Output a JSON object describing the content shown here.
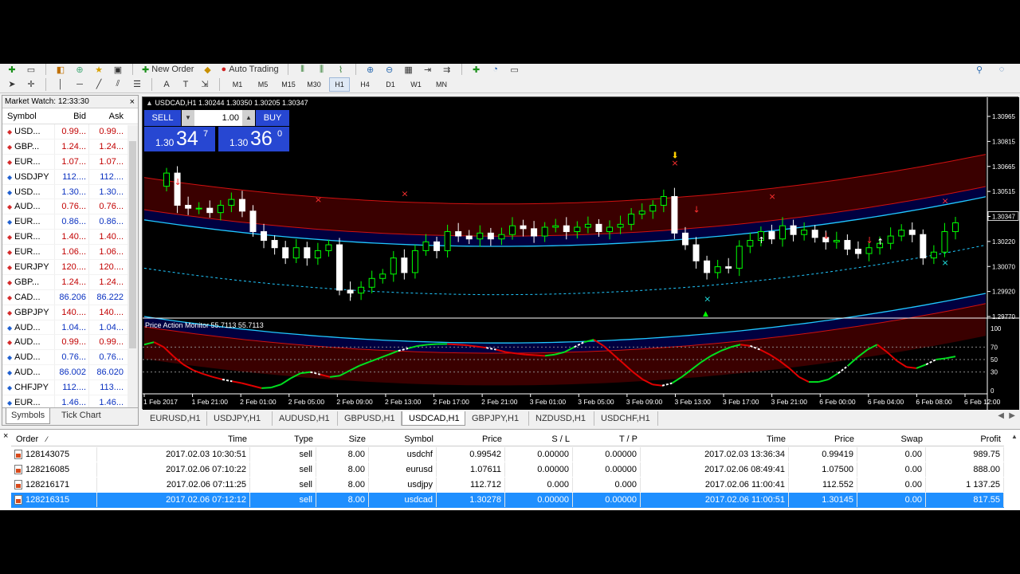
{
  "toolbar": {
    "new_order": "New Order",
    "auto_trading": "Auto Trading",
    "timeframes": [
      "M1",
      "M5",
      "M15",
      "M30",
      "H1",
      "H4",
      "D1",
      "W1",
      "MN"
    ],
    "active_timeframe": "H1"
  },
  "market_watch": {
    "title": "Market Watch: 12:33:30",
    "close": "×",
    "col_symbol": "Symbol",
    "col_bid": "Bid",
    "col_ask": "Ask",
    "rows": [
      {
        "dir": "down",
        "symbol": "USD...",
        "bid": "0.99...",
        "ask": "0.99...",
        "color": "red"
      },
      {
        "dir": "down",
        "symbol": "GBP...",
        "bid": "1.24...",
        "ask": "1.24...",
        "color": "red"
      },
      {
        "dir": "down",
        "symbol": "EUR...",
        "bid": "1.07...",
        "ask": "1.07...",
        "color": "red"
      },
      {
        "dir": "up",
        "symbol": "USDJPY",
        "bid": "112....",
        "ask": "112....",
        "color": "blue"
      },
      {
        "dir": "up",
        "symbol": "USD...",
        "bid": "1.30...",
        "ask": "1.30...",
        "color": "blue"
      },
      {
        "dir": "down",
        "symbol": "AUD...",
        "bid": "0.76...",
        "ask": "0.76...",
        "color": "red"
      },
      {
        "dir": "up",
        "symbol": "EUR...",
        "bid": "0.86...",
        "ask": "0.86...",
        "color": "blue"
      },
      {
        "dir": "down",
        "symbol": "EUR...",
        "bid": "1.40...",
        "ask": "1.40...",
        "color": "red"
      },
      {
        "dir": "down",
        "symbol": "EUR...",
        "bid": "1.06...",
        "ask": "1.06...",
        "color": "red"
      },
      {
        "dir": "down",
        "symbol": "EURJPY",
        "bid": "120....",
        "ask": "120....",
        "color": "red"
      },
      {
        "dir": "down",
        "symbol": "GBP...",
        "bid": "1.24...",
        "ask": "1.24...",
        "color": "red"
      },
      {
        "dir": "down",
        "symbol": "CAD...",
        "bid": "86.206",
        "ask": "86.222",
        "color": "blue"
      },
      {
        "dir": "down",
        "symbol": "GBPJPY",
        "bid": "140....",
        "ask": "140....",
        "color": "red"
      },
      {
        "dir": "up",
        "symbol": "AUD...",
        "bid": "1.04...",
        "ask": "1.04...",
        "color": "blue"
      },
      {
        "dir": "down",
        "symbol": "AUD...",
        "bid": "0.99...",
        "ask": "0.99...",
        "color": "red"
      },
      {
        "dir": "up",
        "symbol": "AUD...",
        "bid": "0.76...",
        "ask": "0.76...",
        "color": "blue"
      },
      {
        "dir": "up",
        "symbol": "AUD...",
        "bid": "86.002",
        "ask": "86.020",
        "color": "blue"
      },
      {
        "dir": "up",
        "symbol": "CHFJPY",
        "bid": "112....",
        "ask": "113....",
        "color": "blue"
      },
      {
        "dir": "up",
        "symbol": "EUR...",
        "bid": "1.46...",
        "ask": "1.46...",
        "color": "blue"
      }
    ],
    "tabs": [
      "Symbols",
      "Tick Chart"
    ]
  },
  "chart": {
    "header": "USDCAD,H1  1.30244 1.30350 1.30205 1.30347",
    "sell": "SELL",
    "buy": "BUY",
    "lot": "1.00",
    "sell_price_small": "1.30",
    "sell_price_big": "34",
    "sell_price_sup": "7",
    "buy_price_small": "1.30",
    "buy_price_big": "36",
    "buy_price_sup": "0",
    "indicator_label": "Price Action Monitor 55.7113 55.7113",
    "price_ticks": [
      "1.30965",
      "1.30815",
      "1.30665",
      "1.30515",
      "1.30347",
      "1.30220",
      "1.30070",
      "1.29920",
      "1.29770"
    ],
    "current_price": "1.30347",
    "osc_ticks": [
      "100",
      "70",
      "50",
      "30",
      "0"
    ],
    "time_labels": [
      "1 Feb 2017",
      "1 Feb 21:00",
      "2 Feb 01:00",
      "2 Feb 05:00",
      "2 Feb 09:00",
      "2 Feb 13:00",
      "2 Feb 17:00",
      "2 Feb 21:00",
      "3 Feb 01:00",
      "3 Feb 05:00",
      "3 Feb 09:00",
      "3 Feb 13:00",
      "3 Feb 17:00",
      "3 Feb 21:00",
      "6 Feb 00:00",
      "6 Feb 04:00",
      "6 Feb 08:00",
      "6 Feb 12:00"
    ]
  },
  "chart_tabs": [
    "EURUSD,H1",
    "USDJPY,H1",
    "AUDUSD,H1",
    "GBPUSD,H1",
    "USDCAD,H1",
    "GBPJPY,H1",
    "NZDUSD,H1",
    "USDCHF,H1"
  ],
  "active_chart_tab": "USDCAD,H1",
  "terminal": {
    "close": "×",
    "headers": {
      "order": "Order",
      "time": "Time",
      "type": "Type",
      "size": "Size",
      "symbol": "Symbol",
      "price": "Price",
      "sl": "S / L",
      "tp": "T / P",
      "time2": "Time",
      "price2": "Price",
      "swap": "Swap",
      "profit": "Profit"
    },
    "rows": [
      {
        "order": "128143075",
        "time": "2017.02.03 10:30:51",
        "type": "sell",
        "size": "8.00",
        "symbol": "usdchf",
        "price": "0.99542",
        "sl": "0.00000",
        "tp": "0.00000",
        "time2": "2017.02.03 13:36:34",
        "price2": "0.99419",
        "swap": "0.00",
        "profit": "989.75"
      },
      {
        "order": "128216085",
        "time": "2017.02.06 07:10:22",
        "type": "sell",
        "size": "8.00",
        "symbol": "eurusd",
        "price": "1.07611",
        "sl": "0.00000",
        "tp": "0.00000",
        "time2": "2017.02.06 08:49:41",
        "price2": "1.07500",
        "swap": "0.00",
        "profit": "888.00"
      },
      {
        "order": "128216171",
        "time": "2017.02.06 07:11:25",
        "type": "sell",
        "size": "8.00",
        "symbol": "usdjpy",
        "price": "112.712",
        "sl": "0.000",
        "tp": "0.000",
        "time2": "2017.02.06 11:00:41",
        "price2": "112.552",
        "swap": "0.00",
        "profit": "1 137.25"
      },
      {
        "order": "128216315",
        "time": "2017.02.06 07:12:12",
        "type": "sell",
        "size": "8.00",
        "symbol": "usdcad",
        "price": "1.30278",
        "sl": "0.00000",
        "tp": "0.00000",
        "time2": "2017.02.06 11:00:51",
        "price2": "1.30145",
        "swap": "0.00",
        "profit": "817.55",
        "selected": true
      }
    ]
  },
  "colors": {
    "bull": "#00ff00",
    "bear": "#ffffff",
    "band_red": "#c80000",
    "band_blue": "#00c8ff",
    "osc_up": "#00e020",
    "osc_down": "#e00000",
    "selected_row": "#1f8fff"
  }
}
